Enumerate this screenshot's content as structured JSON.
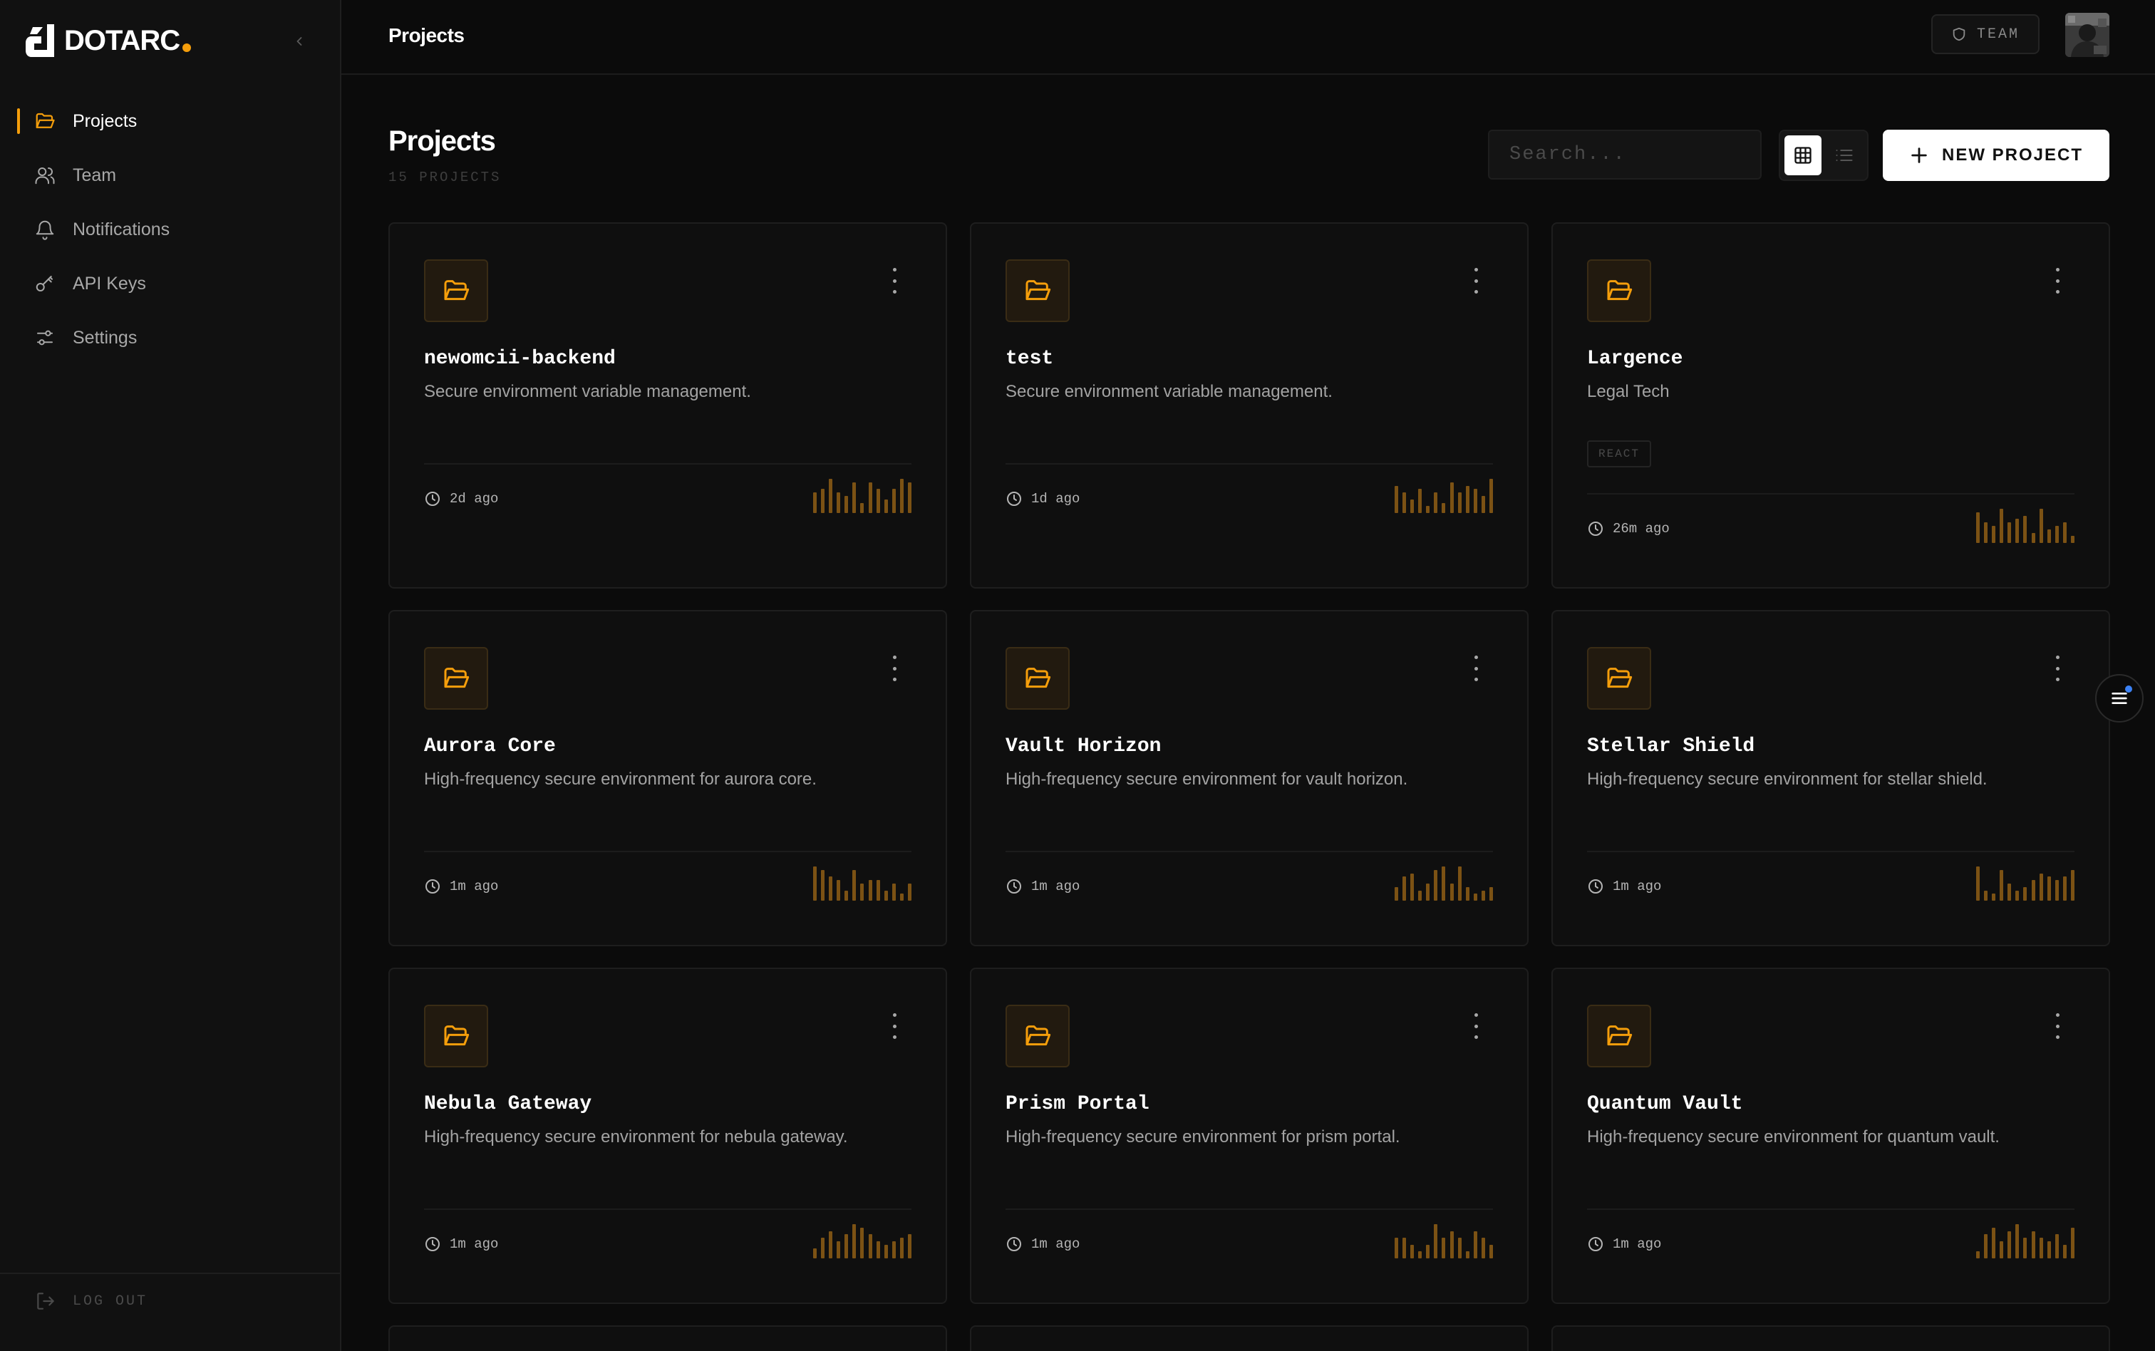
{
  "brand": {
    "name": "DOTARC",
    "accent": "#f59e0b"
  },
  "sidebar": {
    "items": [
      {
        "label": "Projects",
        "icon": "folder-open-icon",
        "active": true
      },
      {
        "label": "Team",
        "icon": "users-icon",
        "active": false
      },
      {
        "label": "Notifications",
        "icon": "bell-icon",
        "active": false
      },
      {
        "label": "API Keys",
        "icon": "key-icon",
        "active": false
      },
      {
        "label": "Settings",
        "icon": "sliders-icon",
        "active": false
      }
    ],
    "logout_label": "LOG OUT"
  },
  "topbar": {
    "title": "Projects",
    "team_label": "TEAM"
  },
  "main": {
    "title": "Projects",
    "count_label": "15 PROJECTS",
    "search_placeholder": "Search...",
    "view_mode": "grid",
    "new_button_label": "NEW PROJECT"
  },
  "projects": [
    {
      "name": "newomcii-backend",
      "description": "Secure environment variable management.",
      "tag": "",
      "time": "2d ago",
      "activity": [
        6,
        7,
        10,
        6,
        5,
        9,
        3,
        9,
        7,
        4,
        7,
        10,
        9
      ]
    },
    {
      "name": "test",
      "description": "Secure environment variable management.",
      "tag": "",
      "time": "1d ago",
      "activity": [
        8,
        6,
        4,
        7,
        2,
        6,
        3,
        9,
        6,
        8,
        7,
        5,
        10
      ]
    },
    {
      "name": "Largence",
      "description": "Legal Tech",
      "tag": "REACT",
      "time": "26m ago",
      "activity": [
        9,
        6,
        5,
        10,
        6,
        7,
        8,
        3,
        10,
        4,
        5,
        6,
        2
      ]
    },
    {
      "name": "Aurora Core",
      "description": "High-frequency secure environment for aurora core.",
      "tag": "",
      "time": "1m ago",
      "activity": [
        10,
        9,
        7,
        6,
        3,
        9,
        5,
        6,
        6,
        3,
        5,
        2,
        5
      ]
    },
    {
      "name": "Vault Horizon",
      "description": "High-frequency secure environment for vault horizon.",
      "tag": "",
      "time": "1m ago",
      "activity": [
        4,
        7,
        8,
        3,
        5,
        9,
        10,
        5,
        10,
        4,
        2,
        3,
        4
      ]
    },
    {
      "name": "Stellar Shield",
      "description": "High-frequency secure environment for stellar shield.",
      "tag": "",
      "time": "1m ago",
      "activity": [
        10,
        3,
        2,
        9,
        5,
        3,
        4,
        6,
        8,
        7,
        6,
        7,
        9
      ]
    },
    {
      "name": "Nebula Gateway",
      "description": "High-frequency secure environment for nebula gateway.",
      "tag": "",
      "time": "1m ago",
      "activity": [
        3,
        6,
        8,
        5,
        7,
        10,
        9,
        7,
        5,
        4,
        5,
        6,
        7
      ]
    },
    {
      "name": "Prism Portal",
      "description": "High-frequency secure environment for prism portal.",
      "tag": "",
      "time": "1m ago",
      "activity": [
        6,
        6,
        4,
        2,
        4,
        10,
        6,
        8,
        6,
        2,
        8,
        6,
        4
      ]
    },
    {
      "name": "Quantum Vault",
      "description": "High-frequency secure environment for quantum vault.",
      "tag": "",
      "time": "1m ago",
      "activity": [
        2,
        7,
        9,
        5,
        8,
        10,
        6,
        8,
        6,
        5,
        7,
        4,
        9
      ]
    }
  ]
}
